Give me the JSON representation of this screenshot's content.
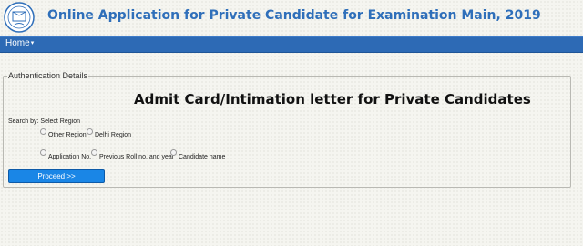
{
  "header": {
    "title": "Online Application for Private Candidate for Examination Main, 2019",
    "logo_icon": "cbse-emblem-icon"
  },
  "nav": {
    "home_label": "Home",
    "home_caret_icon": "caret-down-icon"
  },
  "form": {
    "legend": "Authentication Details",
    "page_title": "Admit Card/Intimation letter for Private Candidates",
    "search_by_label": "Search by: Select Region",
    "region_options": [
      "Other Region",
      "Delhi Region"
    ],
    "search_options": [
      "Application No.",
      "Previous Roll no. and year",
      "Candidate name"
    ],
    "proceed_label": "Proceed >>"
  },
  "colors": {
    "title_blue": "#2f6fba",
    "navbar_blue": "#2d6ab5",
    "button_blue": "#1a86e6"
  }
}
